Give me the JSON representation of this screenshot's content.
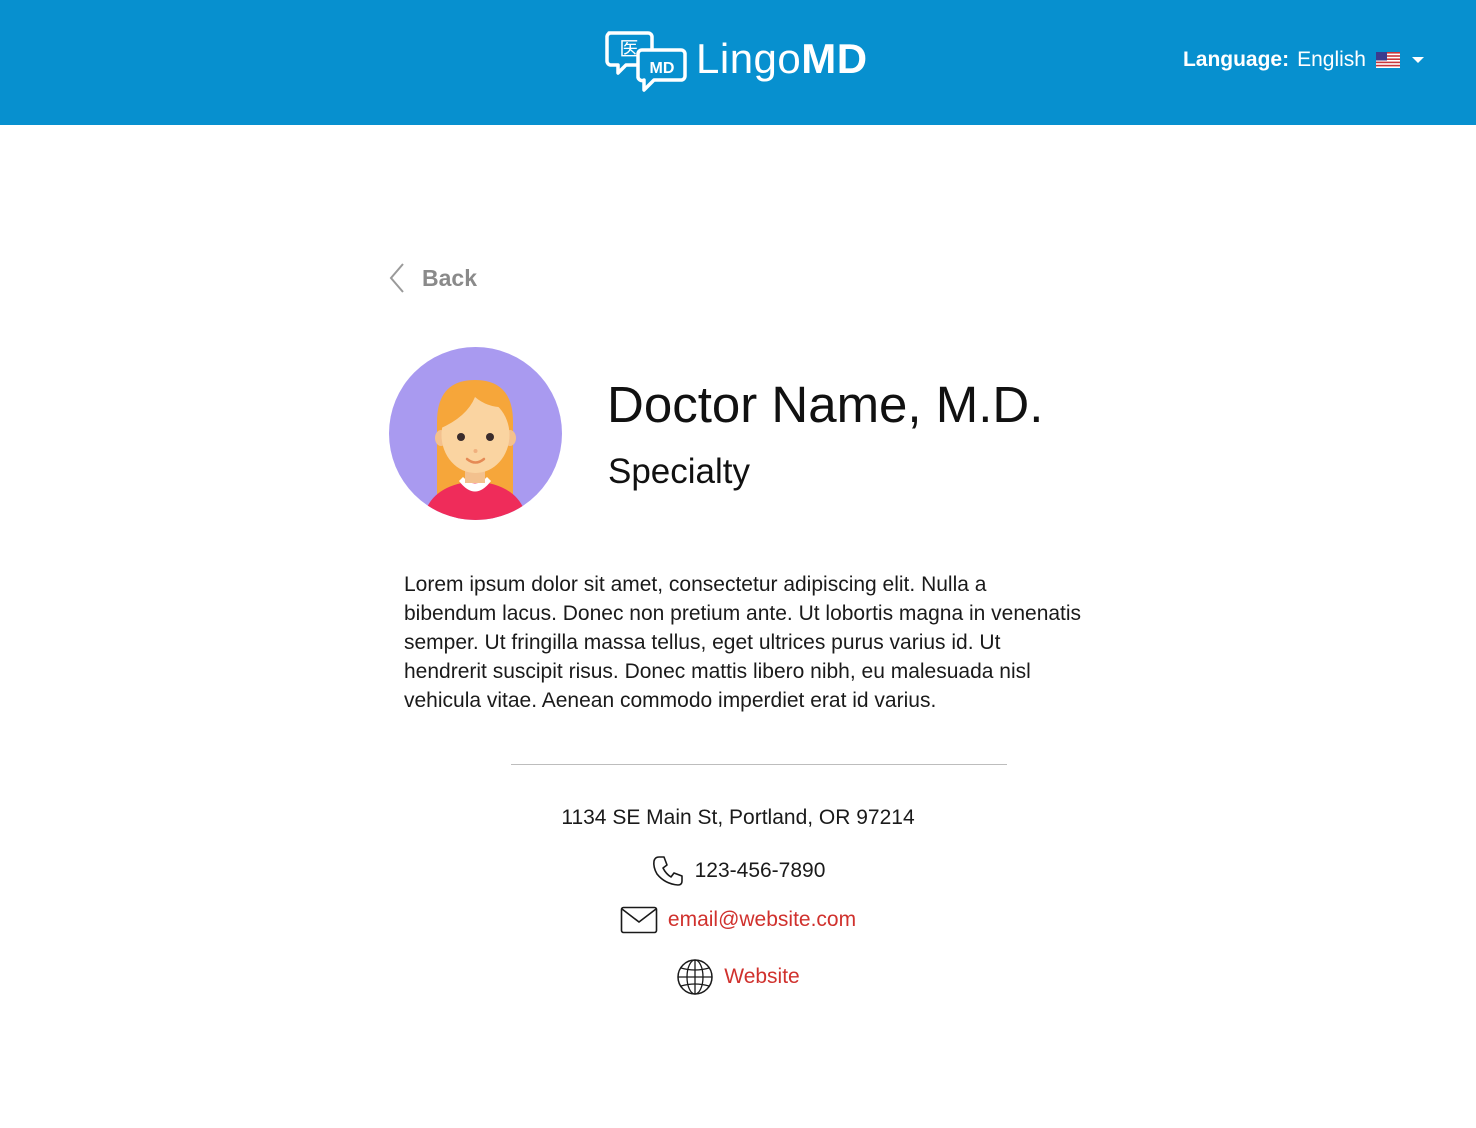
{
  "header": {
    "brand": {
      "icon_glyph": "医",
      "icon_badge": "MD",
      "name_light": "Lingo",
      "name_bold": "MD"
    },
    "language": {
      "label": "Language:",
      "value": "English",
      "flag": "us-flag-icon"
    }
  },
  "nav": {
    "back_label": "Back"
  },
  "profile": {
    "name": "Doctor Name, M.D.",
    "specialty": "Specialty",
    "bio": "Lorem ipsum dolor sit amet, consectetur adipiscing elit. Nulla a bibendum lacus. Donec non pretium ante. Ut lobortis magna in venenatis semper. Ut fringilla massa tellus, eget ultrices purus varius id. Ut hendrerit suscipit risus. Donec mattis libero nibh, eu malesuada nisl vehicula vitae. Aenean commodo imperdiet erat id varius."
  },
  "contact": {
    "address": "1134 SE Main St, Portland, OR 97214",
    "phone": "123-456-7890",
    "email": "email@website.com",
    "website": "Website"
  },
  "colors": {
    "header_bg": "#0790cf",
    "link": "#d0312d",
    "avatar_bg": "#a99af0"
  }
}
